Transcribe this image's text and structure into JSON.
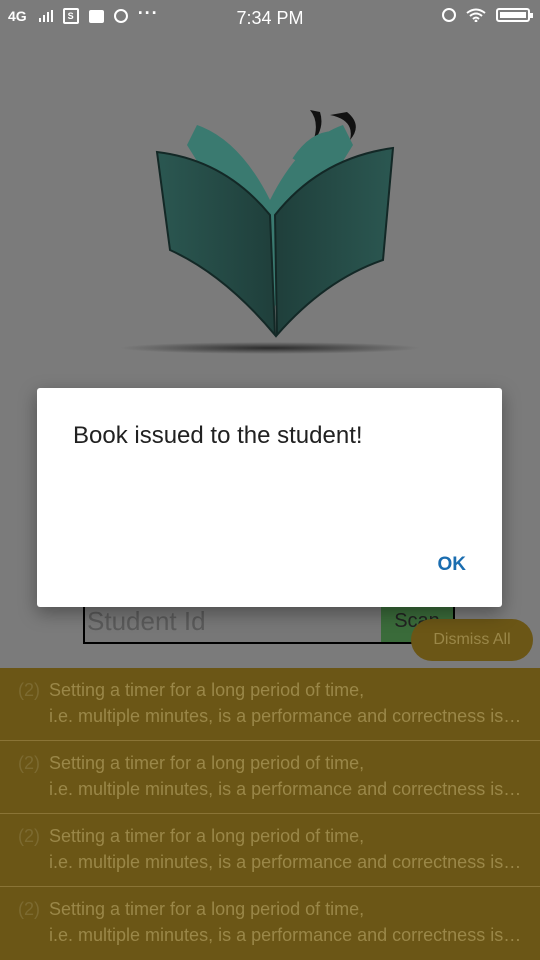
{
  "status_bar": {
    "network": "4G",
    "time": "7:34 PM",
    "sim_badge": "S",
    "more": "···"
  },
  "form": {
    "student_id_placeholder": "Student Id",
    "scan_label": "Scan"
  },
  "dismiss_all_label": "Dismiss All",
  "notifications": [
    {
      "count": "(2)",
      "line1": "Setting a timer for a long period of time,",
      "line2": "i.e. multiple minutes, is a performance and correctness issue"
    },
    {
      "count": "(2)",
      "line1": "Setting a timer for a long period of time,",
      "line2": "i.e. multiple minutes, is a performance and correctness issue"
    },
    {
      "count": "(2)",
      "line1": "Setting a timer for a long period of time,",
      "line2": "i.e. multiple minutes, is a performance and correctness issue"
    },
    {
      "count": "(2)",
      "line1": "Setting a timer for a long period of time,",
      "line2": "i.e. multiple minutes, is a performance and correctness issue"
    }
  ],
  "dialog": {
    "message": "Book issued to the student!",
    "ok_label": "OK"
  },
  "colors": {
    "accent": "#1a6db0",
    "book": "#2e5f57",
    "notification_bg": "#6b5616"
  }
}
